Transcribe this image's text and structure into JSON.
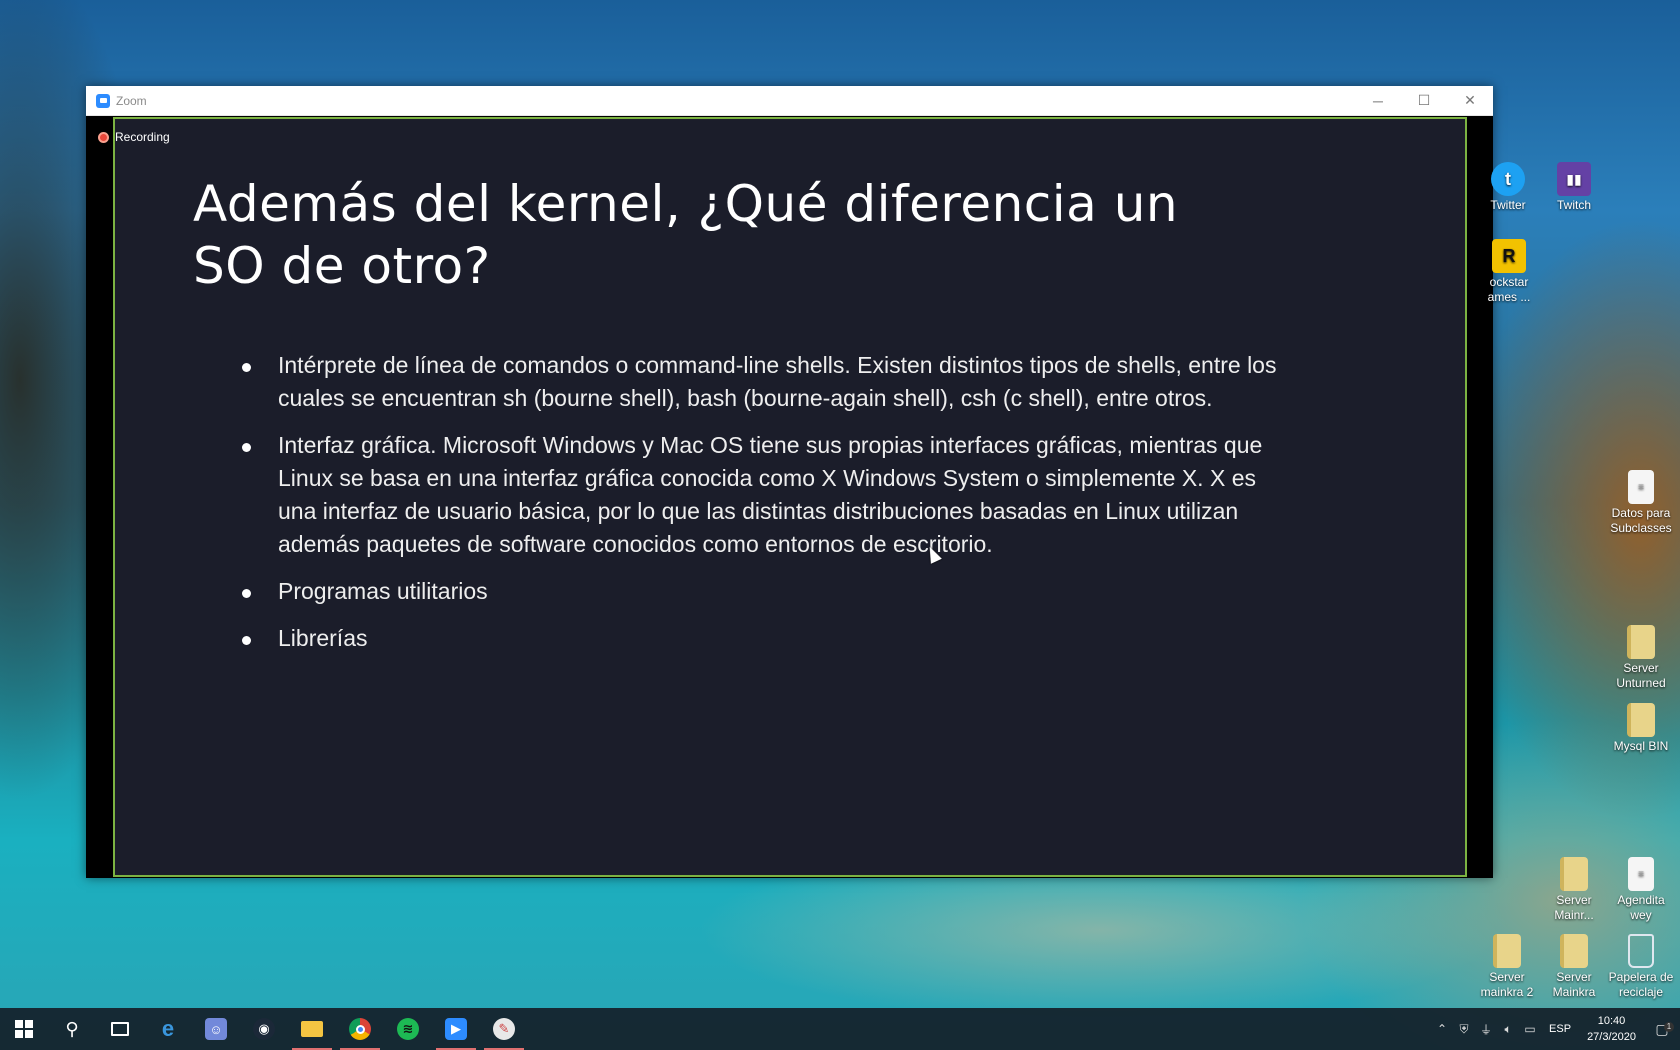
{
  "window": {
    "title": "Zoom",
    "controls": {
      "minimize": "─",
      "maximize": "☐",
      "close": "✕"
    },
    "recording_label": "Recording"
  },
  "slide": {
    "title_line1": "Además del kernel, ¿Qué diferencia un",
    "title_line2": "SO de otro?",
    "bullets": [
      "Intérprete de línea de comandos o command-line shells. Existen distintos tipos de shells, entre los cuales se encuentran sh (bourne shell), bash (bourne-again shell), csh (c shell), entre otros.",
      "Interfaz gráfica. Microsoft Windows y Mac OS tiene sus propias interfaces gráficas, mientras que Linux se basa en una interfaz gráfica conocida como X Windows System o simplemente X. X es una interfaz de usuario básica, por lo que las distintas distribuciones basadas en Linux utilizan además paquetes de software conocidos como entornos de escritorio.",
      "Programas utilitarios",
      "Librerías"
    ]
  },
  "desktop_icons": {
    "twitter": {
      "label": "Twitter",
      "icon": "twitter-bird-icon"
    },
    "twitch": {
      "label": "Twitch",
      "icon": "twitch-icon"
    },
    "rockstar": {
      "label": "Rockstar Games ...",
      "visible_label_line1": "ockstar",
      "visible_label_line2": "ames ...",
      "icon": "rockstar-icon"
    },
    "datos": {
      "label": "Datos para Subclasses",
      "line1": "Datos para",
      "line2": "Subclasses",
      "icon": "document-icon"
    },
    "unturned": {
      "line1": "Server",
      "line2": "Unturned",
      "icon": "folder-zip-icon"
    },
    "mysql": {
      "line1": "Mysql BIN",
      "icon": "folder-shortcut-icon"
    },
    "mainr": {
      "line1": "Server",
      "line2": "Mainr...",
      "icon": "folder-zip-icon"
    },
    "agendita": {
      "line1": "Agendita",
      "line2": "wey",
      "icon": "document-icon"
    },
    "mainkra2": {
      "line1": "Server",
      "line2": "mainkra 2",
      "icon": "folder-zip-icon"
    },
    "mainkra": {
      "line1": "Server",
      "line2": "Mainkra",
      "icon": "folder-zip-icon"
    },
    "recycle": {
      "line1": "Papelera de",
      "line2": "reciclaje",
      "icon": "recycle-bin-icon"
    }
  },
  "taskbar": {
    "apps": [
      "start-icon",
      "search-icon",
      "task-view-icon",
      "edge-icon",
      "discord-icon",
      "steam-icon",
      "file-explorer-icon",
      "chrome-icon",
      "spotify-icon",
      "zoom-icon",
      "paint-icon"
    ],
    "tray": {
      "language": "ESP",
      "time": "10:40",
      "date": "27/3/2020",
      "notification_count": "1"
    }
  },
  "colors": {
    "slide_bg": "#1b1d2a",
    "slide_border": "#7cb342",
    "zoom_blue": "#2d8cff",
    "recording_red": "#e8473a"
  }
}
